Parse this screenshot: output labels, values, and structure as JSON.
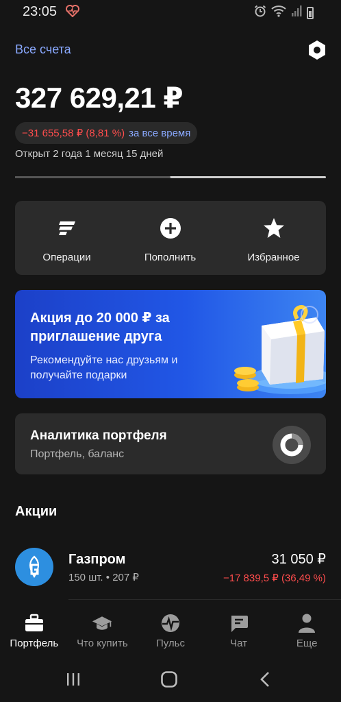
{
  "status_bar": {
    "time": "23:05"
  },
  "header": {
    "accounts_link": "Все счета"
  },
  "portfolio": {
    "balance": "327 629,21 ₽",
    "change": "−31 655,58 ₽ (8,81 %)",
    "change_period": "за все время",
    "opened": "Открыт 2 года 1 месяц 15 дней",
    "progress_fraction": 0.5
  },
  "actions": [
    {
      "label": "Операции",
      "icon": "operations-icon"
    },
    {
      "label": "Пополнить",
      "icon": "plus-circle-icon"
    },
    {
      "label": "Избранное",
      "icon": "star-icon"
    }
  ],
  "promo": {
    "title": "Акция до 20 000 ₽ за приглашение друга",
    "subtitle": "Рекомендуйте нас друзьям и получайте подарки"
  },
  "analytics": {
    "title": "Аналитика портфеля",
    "subtitle": "Портфель, баланс"
  },
  "stocks": {
    "section_title": "Акции",
    "items": [
      {
        "name": "Газпром",
        "qty": "150 шт. • 207 ₽",
        "value": "31 050 ₽",
        "change": "−17 839,5 ₽ (36,49 %)"
      }
    ]
  },
  "tabs": [
    {
      "label": "Портфель",
      "icon": "briefcase-icon",
      "active": true
    },
    {
      "label": "Что купить",
      "icon": "graduation-cap-icon",
      "active": false
    },
    {
      "label": "Пульс",
      "icon": "pulse-icon",
      "active": false
    },
    {
      "label": "Чат",
      "icon": "chat-icon",
      "active": false
    },
    {
      "label": "Еще",
      "icon": "profile-icon",
      "active": false
    }
  ],
  "colors": {
    "background": "#151515",
    "card": "#2b2b2b",
    "accent": "#8aa9ff",
    "negative": "#ff4d4d",
    "promo": "#2157e6"
  }
}
